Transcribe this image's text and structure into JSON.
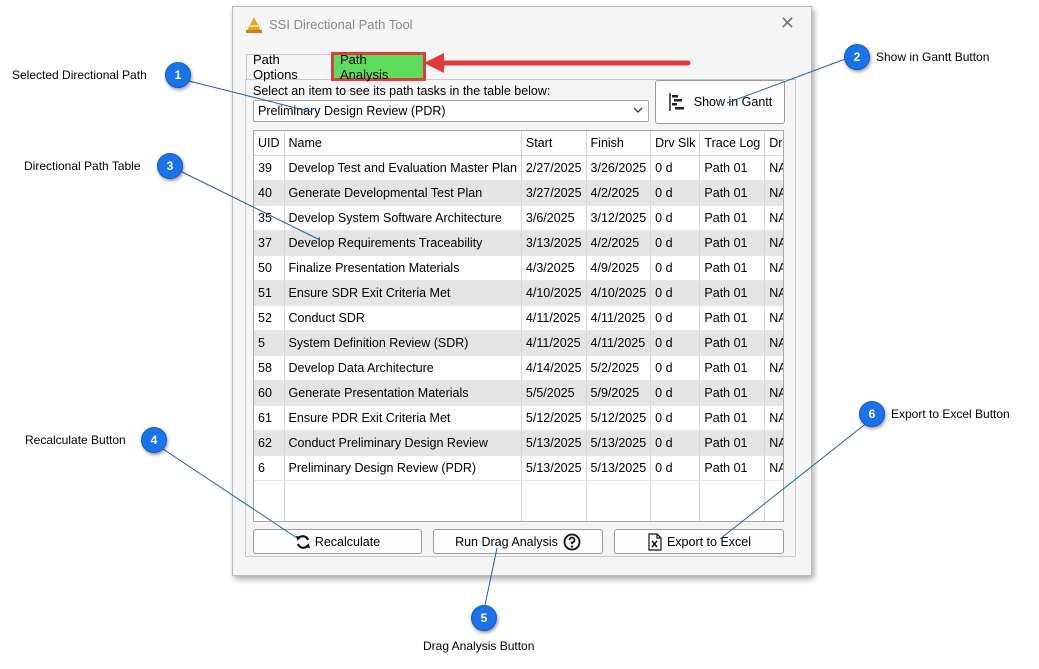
{
  "window": {
    "title": "SSI Directional Path Tool",
    "close_glyph": "✕"
  },
  "tabs": [
    {
      "label": "Path Options"
    },
    {
      "label": "Path Analysis",
      "highlight": "#5cde5c",
      "outline": "#e23a3a"
    }
  ],
  "path_select": {
    "prompt": "Select an item to see its path tasks in the table below:",
    "value": "Preliminary Design Review (PDR)"
  },
  "gantt_button": {
    "label": "Show in Gantt",
    "icon": "gantt-icon"
  },
  "table": {
    "columns": [
      "UID",
      "Name",
      "Start",
      "Finish",
      "Drv Slk",
      "Trace Log",
      "Drag"
    ],
    "rows": [
      [
        "39",
        "Develop Test and Evaluation Master Plan",
        "2/27/2025",
        "3/26/2025",
        "0 d",
        "Path 01",
        "NA"
      ],
      [
        "40",
        "Generate Developmental Test Plan",
        "3/27/2025",
        "4/2/2025",
        "0 d",
        "Path 01",
        "NA"
      ],
      [
        "35",
        "Develop System Software Architecture",
        "3/6/2025",
        "3/12/2025",
        "0 d",
        "Path 01",
        "NA"
      ],
      [
        "37",
        "Develop Requirements Traceability",
        "3/13/2025",
        "4/2/2025",
        "0 d",
        "Path 01",
        "NA"
      ],
      [
        "50",
        "Finalize Presentation Materials",
        "4/3/2025",
        "4/9/2025",
        "0 d",
        "Path 01",
        "NA"
      ],
      [
        "51",
        "Ensure SDR Exit Criteria Met",
        "4/10/2025",
        "4/10/2025",
        "0 d",
        "Path 01",
        "NA"
      ],
      [
        "52",
        "Conduct SDR",
        "4/11/2025",
        "4/11/2025",
        "0 d",
        "Path 01",
        "NA"
      ],
      [
        "5",
        "System Definition Review (SDR)",
        "4/11/2025",
        "4/11/2025",
        "0 d",
        "Path 01",
        "NA"
      ],
      [
        "58",
        "Develop Data Architecture",
        "4/14/2025",
        "5/2/2025",
        "0 d",
        "Path 01",
        "NA"
      ],
      [
        "60",
        "Generate Presentation Materials",
        "5/5/2025",
        "5/9/2025",
        "0 d",
        "Path 01",
        "NA"
      ],
      [
        "61",
        "Ensure PDR Exit Criteria Met",
        "5/12/2025",
        "5/12/2025",
        "0 d",
        "Path 01",
        "NA"
      ],
      [
        "62",
        "Conduct Preliminary Design Review",
        "5/13/2025",
        "5/13/2025",
        "0 d",
        "Path 01",
        "NA"
      ],
      [
        "6",
        "Preliminary Design Review (PDR)",
        "5/13/2025",
        "5/13/2025",
        "0 d",
        "Path 01",
        "NA"
      ]
    ]
  },
  "buttons": {
    "recalculate": {
      "label": "Recalculate",
      "icon": "refresh-icon"
    },
    "drag": {
      "label": "Run Drag Analysis",
      "icon": "help-icon"
    },
    "export": {
      "label": "Export to Excel",
      "icon": "excel-icon"
    }
  },
  "callouts": [
    {
      "number": "1",
      "label": "Selected Directional Path"
    },
    {
      "number": "2",
      "label": "Show in Gantt Button"
    },
    {
      "number": "3",
      "label": "Directional Path Table"
    },
    {
      "number": "4",
      "label": "Recalculate Button"
    },
    {
      "number": "5",
      "label": "Drag Analysis Button"
    },
    {
      "number": "6",
      "label": "Export to Excel Button"
    }
  ],
  "colors": {
    "callout": "#1a73e8",
    "arrow": "#e23a3a",
    "leader": "#1f5fa8"
  }
}
